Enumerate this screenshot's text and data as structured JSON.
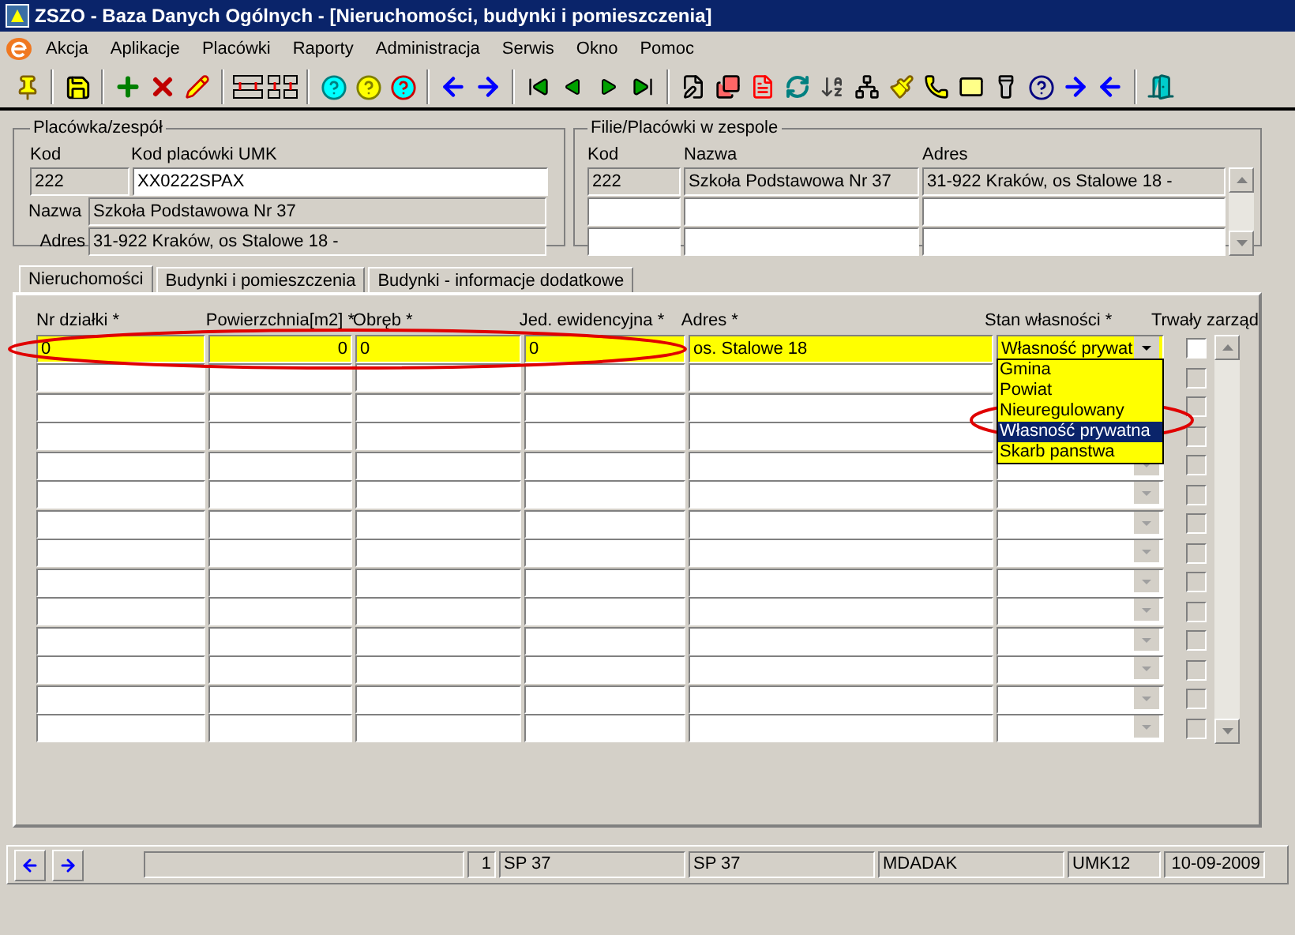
{
  "window": {
    "title": "ZSZO - Baza Danych Ogólnych - [Nieruchomości, budynki i pomieszczenia]"
  },
  "menu": [
    "Akcja",
    "Aplikacje",
    "Placówki",
    "Raporty",
    "Administracja",
    "Serwis",
    "Okno",
    "Pomoc"
  ],
  "placowka": {
    "title": "Placówka/zespół",
    "kod_label": "Kod",
    "kod": "222",
    "umk_label": "Kod placówki UMK",
    "umk": "XX0222SPAX",
    "nazwa_label": "Nazwa",
    "nazwa": "Szkoła Podstawowa Nr  37",
    "adres_label": "Adres",
    "adres": "31-922 Kraków, os Stalowe 18 -"
  },
  "filie": {
    "title": "Filie/Placówki w zespole",
    "columns": [
      "Kod",
      "Nazwa",
      "Adres"
    ],
    "rows": [
      [
        "222",
        "Szkoła Podstawowa Nr  37",
        "31-922 Kraków, os Stalowe 18 -"
      ]
    ]
  },
  "tabs": [
    {
      "label": "Nieruchomości",
      "selected": true
    },
    {
      "label": "Budynki i pomieszczenia",
      "selected": false
    },
    {
      "label": "Budynki - informacje dodatkowe",
      "selected": false
    }
  ],
  "grid": {
    "columns": [
      "Nr działki *",
      "Powierzchnia[m2] *",
      "Obręb *",
      "Jed. ewidencyjna *",
      "Adres *",
      "Stan własności *",
      "Trwały zarząd"
    ],
    "rows": [
      {
        "cells": [
          "0",
          "0",
          "0",
          "0",
          "os. Stalowe 18",
          "Własność prywat"
        ],
        "current": true,
        "checked": false,
        "disabled": false
      },
      {
        "current": false,
        "checked": false,
        "disabled": true
      },
      {
        "current": false,
        "checked": false,
        "disabled": true
      },
      {
        "current": false,
        "checked": false,
        "disabled": true
      },
      {
        "current": false,
        "checked": false,
        "disabled": true
      },
      {
        "current": false,
        "checked": false,
        "disabled": true
      },
      {
        "current": false,
        "checked": false,
        "disabled": true
      },
      {
        "current": false,
        "checked": false,
        "disabled": true
      },
      {
        "current": false,
        "checked": false,
        "disabled": true
      },
      {
        "current": false,
        "checked": false,
        "disabled": true
      },
      {
        "current": false,
        "checked": false,
        "disabled": true
      },
      {
        "current": false,
        "checked": false,
        "disabled": true
      },
      {
        "current": false,
        "checked": false,
        "disabled": true
      },
      {
        "current": false,
        "checked": false,
        "disabled": true
      }
    ]
  },
  "dropdown": {
    "open": true,
    "options": [
      {
        "label": "Gmina",
        "selected": false
      },
      {
        "label": "Powiat",
        "selected": false
      },
      {
        "label": "Nieuregulowany",
        "selected": false
      },
      {
        "label": "Własność prywatna",
        "selected": true
      },
      {
        "label": "Skarb panstwa",
        "selected": false
      }
    ]
  },
  "status_bar": {
    "fields": [
      "1",
      "SP 37",
      "SP 37",
      "MDADAK",
      "UMK12",
      "10-09-2009"
    ]
  }
}
